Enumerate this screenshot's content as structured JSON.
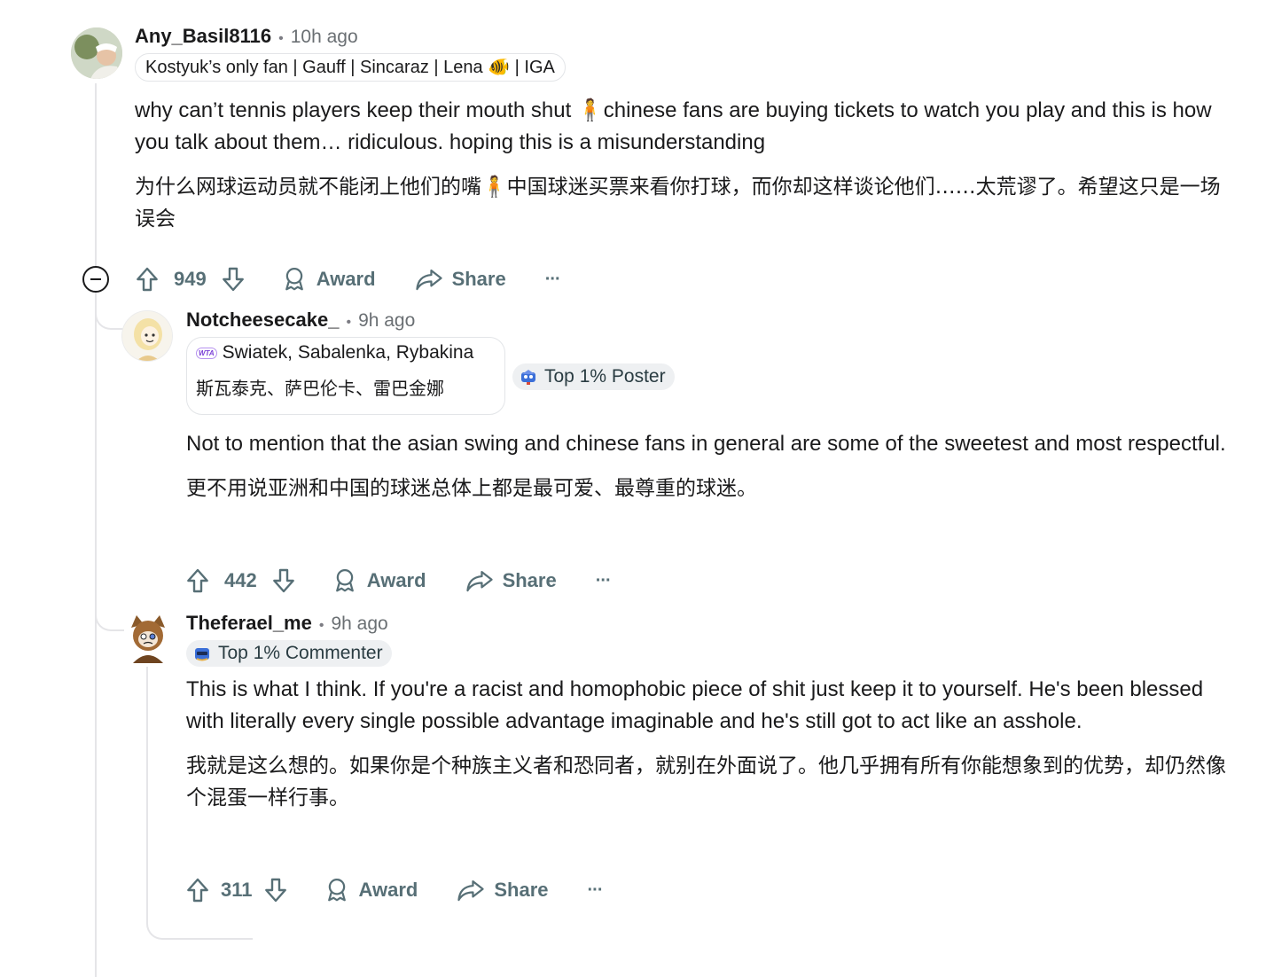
{
  "comments": [
    {
      "username": "Any_Basil8116",
      "time": "10h ago",
      "flair": "Kostyuk’s only fan | Gauff | Sincaraz | Lena 🐠 | IGA",
      "body_en": "why can’t tennis players keep their mouth shut 🧍chinese fans are buying tickets to watch you play and this is how you talk about them… ridiculous. hoping this is a misunderstanding",
      "body_zh": "为什么网球运动员就不能闭上他们的嘴🧍中国球迷买票来看你打球，而你却这样谈论他们……太荒谬了。希望这只是一场误会",
      "score": "949",
      "award": "Award",
      "share": "Share",
      "more": "···"
    },
    {
      "username": "Notcheesecake_",
      "time": "9h ago",
      "flair_line1": "Swiatek, Sabalenka, Rybakina",
      "flair_line2": "斯瓦泰克、萨巴伦卡、雷巴金娜",
      "flair_logo": "WTA",
      "badge": "Top 1% Poster",
      "body_en": "Not to mention that the asian swing and chinese fans in general are some of the sweetest and most respectful.",
      "body_zh": "更不用说亚洲和中国的球迷总体上都是最可爱、最尊重的球迷。",
      "score": "442",
      "award": "Award",
      "share": "Share",
      "more": "···"
    },
    {
      "username": "Theferael_me",
      "time": "9h ago",
      "badge": "Top 1% Commenter",
      "body_en": "This is what I think. If you're a racist and homophobic piece of shit just keep it to yourself. He's been blessed with literally every single possible advantage imaginable and he's still got to act like an asshole.",
      "body_zh": "我就是这么想的。如果你是个种族主义者和恐同者，就别在外面说了。他几乎拥有所有你能想象到的优势，却仍然像个混蛋一样行事。",
      "score": "311",
      "award": "Award",
      "share": "Share",
      "more": "···"
    }
  ],
  "dot": "•",
  "colors": {
    "text": "#1a1a1b",
    "muted": "#576f76",
    "thread_line": "#e5e5e8",
    "badge_bg": "#eef0f2"
  },
  "icons": [
    "upvote-icon",
    "downvote-icon",
    "award-icon",
    "share-icon",
    "collapse-icon",
    "more-icon"
  ]
}
